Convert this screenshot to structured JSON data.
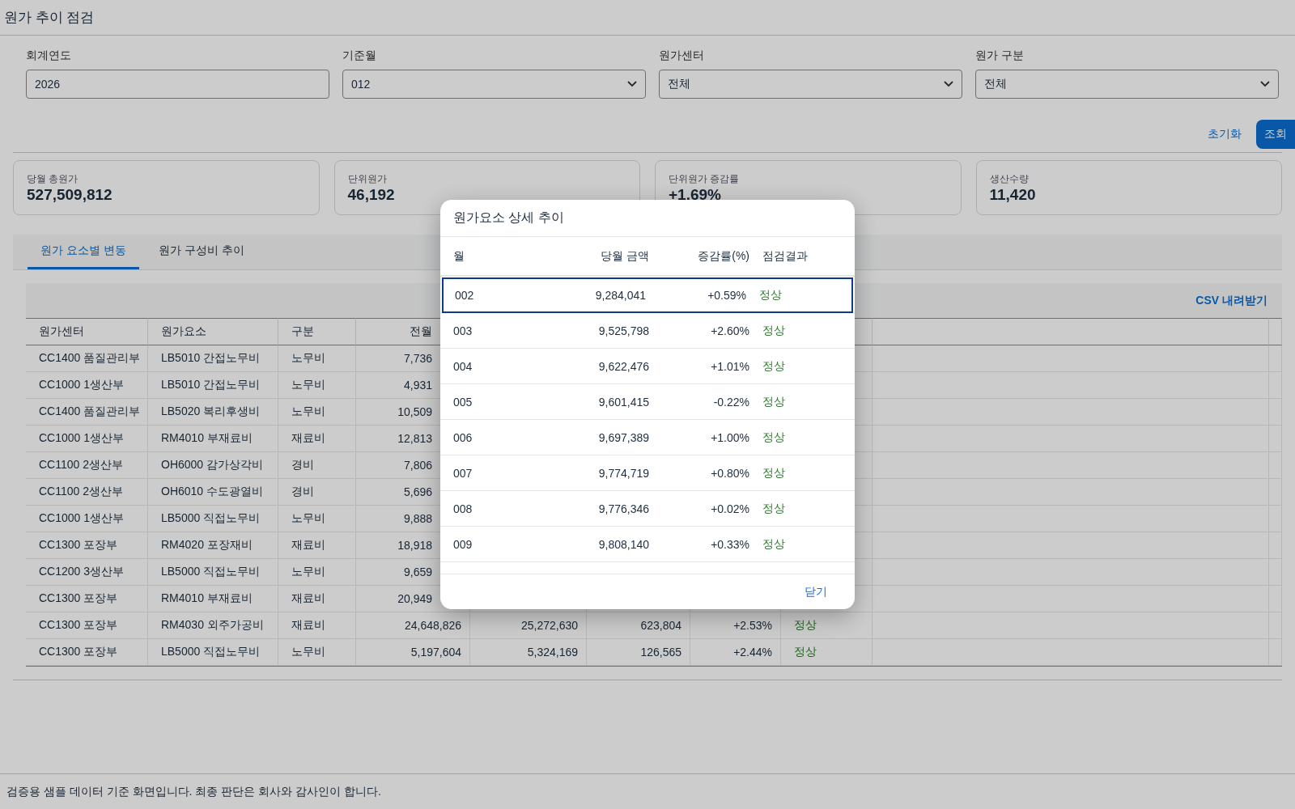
{
  "page_title": "원가 추이 점검",
  "filters": [
    {
      "kind": "input",
      "label": "회계연도",
      "value": "2026"
    },
    {
      "kind": "select",
      "label": "기준월",
      "value": "012"
    },
    {
      "kind": "select",
      "label": "원가센터",
      "value": "전체"
    },
    {
      "kind": "select",
      "label": "원가 구분",
      "value": "전체"
    }
  ],
  "actions": {
    "reset": "초기화",
    "search": "조회"
  },
  "kpis": [
    {
      "label": "당월 총원가",
      "value": "527,509,812"
    },
    {
      "label": "단위원가",
      "value": "46,192"
    },
    {
      "label": "단위원가 증감률",
      "value": "+1.69%"
    },
    {
      "label": "생산수량",
      "value": "11,420"
    }
  ],
  "tabs": [
    {
      "label": "원가 요소별 변동",
      "selected": true
    },
    {
      "label": "원가 구성비 추이",
      "selected": false
    }
  ],
  "table": {
    "download": "CSV 내려받기",
    "columns": [
      "원가센터",
      "원가요소",
      "구분",
      "전월"
    ],
    "rows": [
      {
        "cells": [
          "CC1400 품질관리부",
          "LB5010 간접노무비",
          "노무비",
          "7,736"
        ]
      },
      {
        "cells": [
          "CC1000 1생산부",
          "LB5010 간접노무비",
          "노무비",
          "4,931"
        ]
      },
      {
        "cells": [
          "CC1400 품질관리부",
          "LB5020 복리후생비",
          "노무비",
          "10,509"
        ]
      },
      {
        "cells": [
          "CC1000 1생산부",
          "RM4010 부재료비",
          "재료비",
          "12,813"
        ]
      },
      {
        "cells": [
          "CC1100 2생산부",
          "OH6000 감가상각비",
          "경비",
          "7,806"
        ]
      },
      {
        "cells": [
          "CC1100 2생산부",
          "OH6010 수도광열비",
          "경비",
          "5,696"
        ]
      },
      {
        "cells": [
          "CC1000 1생산부",
          "LB5000 직접노무비",
          "노무비",
          "9,888"
        ]
      },
      {
        "cells": [
          "CC1300 포장부",
          "RM4020 포장재비",
          "재료비",
          "18,918"
        ]
      },
      {
        "cells": [
          "CC1200 3생산부",
          "LB5000 직접노무비",
          "노무비",
          "9,659"
        ]
      },
      {
        "cells": [
          "CC1300 포장부",
          "RM4010 부재료비",
          "재료비",
          "20,949"
        ]
      },
      {
        "cells": [
          "CC1300 포장부",
          "RM4030 외주가공비",
          "재료비",
          "24,648,826",
          "25,272,630",
          "623,804",
          "+2.53%",
          "정상"
        ]
      },
      {
        "cells": [
          "CC1300 포장부",
          "LB5000 직접노무비",
          "노무비",
          "5,197,604",
          "5,324,169",
          "126,565",
          "+2.44%",
          "정상"
        ]
      }
    ]
  },
  "modal": {
    "title": "원가요소 상세 추이",
    "columns": [
      "월",
      "당월 금액",
      "증감률(%)",
      "점검결과"
    ],
    "rows": [
      {
        "month": "002",
        "amount": "9,284,041",
        "rate": "+0.59%",
        "result": "정상",
        "selected": true
      },
      {
        "month": "003",
        "amount": "9,525,798",
        "rate": "+2.60%",
        "result": "정상",
        "selected": false
      },
      {
        "month": "004",
        "amount": "9,622,476",
        "rate": "+1.01%",
        "result": "정상",
        "selected": false
      },
      {
        "month": "005",
        "amount": "9,601,415",
        "rate": "-0.22%",
        "result": "정상",
        "selected": false
      },
      {
        "month": "006",
        "amount": "9,697,389",
        "rate": "+1.00%",
        "result": "정상",
        "selected": false
      },
      {
        "month": "007",
        "amount": "9,774,719",
        "rate": "+0.80%",
        "result": "정상",
        "selected": false
      },
      {
        "month": "008",
        "amount": "9,776,346",
        "rate": "+0.02%",
        "result": "정상",
        "selected": false
      },
      {
        "month": "009",
        "amount": "9,808,140",
        "rate": "+0.33%",
        "result": "정상",
        "selected": false
      }
    ],
    "close": "닫기"
  },
  "footer": "검증용 샘플 데이터 기준 화면입니다. 최종 판단은 회사와 감사인이 합니다."
}
